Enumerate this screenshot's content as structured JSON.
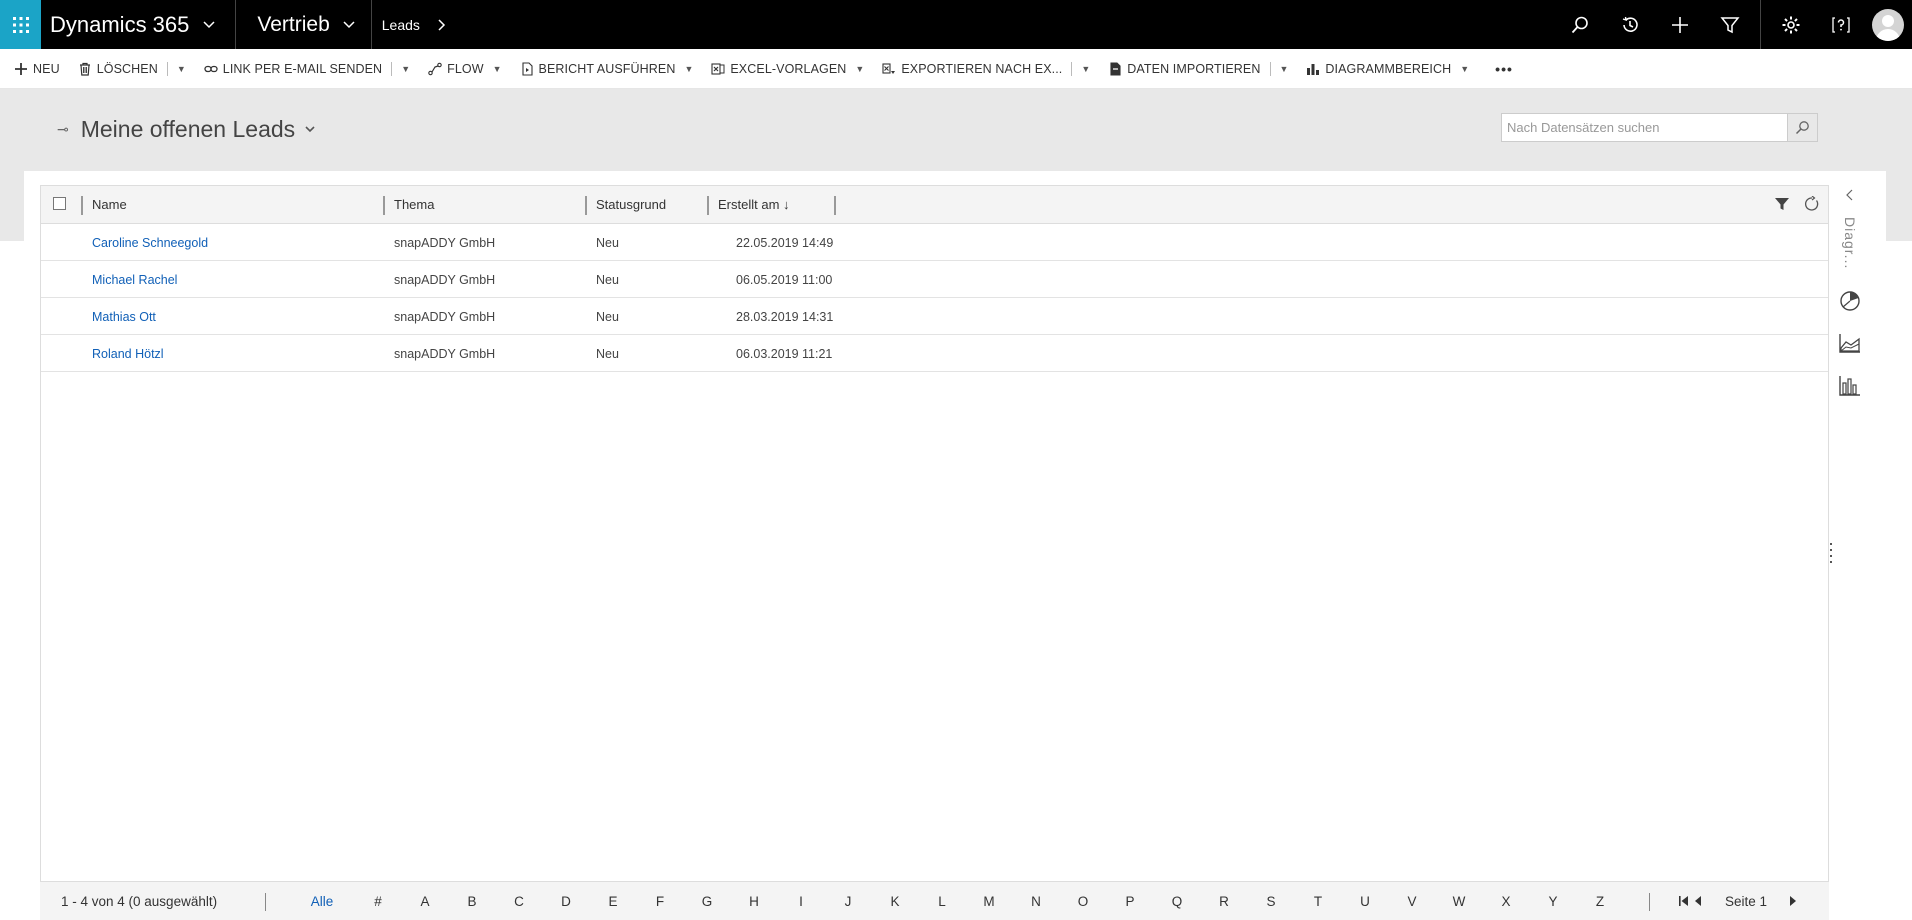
{
  "topbar": {
    "app_title": "Dynamics 365",
    "area": "Vertrieb",
    "breadcrumb": "Leads",
    "accent_color": "#1ba4c7"
  },
  "commands": {
    "new": "NEU",
    "delete": "LÖSCHEN",
    "email_link": "LINK PER E-MAIL SENDEN",
    "flow": "FLOW",
    "run_report": "BERICHT AUSFÜHREN",
    "excel_templates": "EXCEL-VORLAGEN",
    "export_excel": "EXPORTIEREN NACH EX...",
    "import_data": "DATEN IMPORTIEREN",
    "chart_pane": "DIAGRAMMBEREICH",
    "more": "•••"
  },
  "view": {
    "title": "Meine offenen Leads",
    "search_placeholder": "Nach Datensätzen suchen"
  },
  "grid": {
    "columns": {
      "name": "Name",
      "topic": "Thema",
      "status_reason": "Statusgrund",
      "created_on": "Erstellt am ↓"
    },
    "rows": [
      {
        "name": "Caroline Schneegold",
        "topic": "snapADDY GmbH",
        "status": "Neu",
        "created": "22.05.2019 14:49"
      },
      {
        "name": "Michael Rachel",
        "topic": "snapADDY GmbH",
        "status": "Neu",
        "created": "06.05.2019 11:00"
      },
      {
        "name": "Mathias Ott",
        "topic": "snapADDY GmbH",
        "status": "Neu",
        "created": "28.03.2019 14:31"
      },
      {
        "name": "Roland Hötzl",
        "topic": "snapADDY GmbH",
        "status": "Neu",
        "created": "06.03.2019 11:21"
      }
    ]
  },
  "footer": {
    "count": "1 - 4  von 4 (0 ausgewählt)",
    "letters": [
      "Alle",
      "#",
      "A",
      "B",
      "C",
      "D",
      "E",
      "F",
      "G",
      "H",
      "I",
      "J",
      "K",
      "L",
      "M",
      "N",
      "O",
      "P",
      "Q",
      "R",
      "S",
      "T",
      "U",
      "V",
      "W",
      "X",
      "Y",
      "Z"
    ],
    "page": "Seite 1"
  },
  "rail": {
    "label": "Diagr..."
  }
}
